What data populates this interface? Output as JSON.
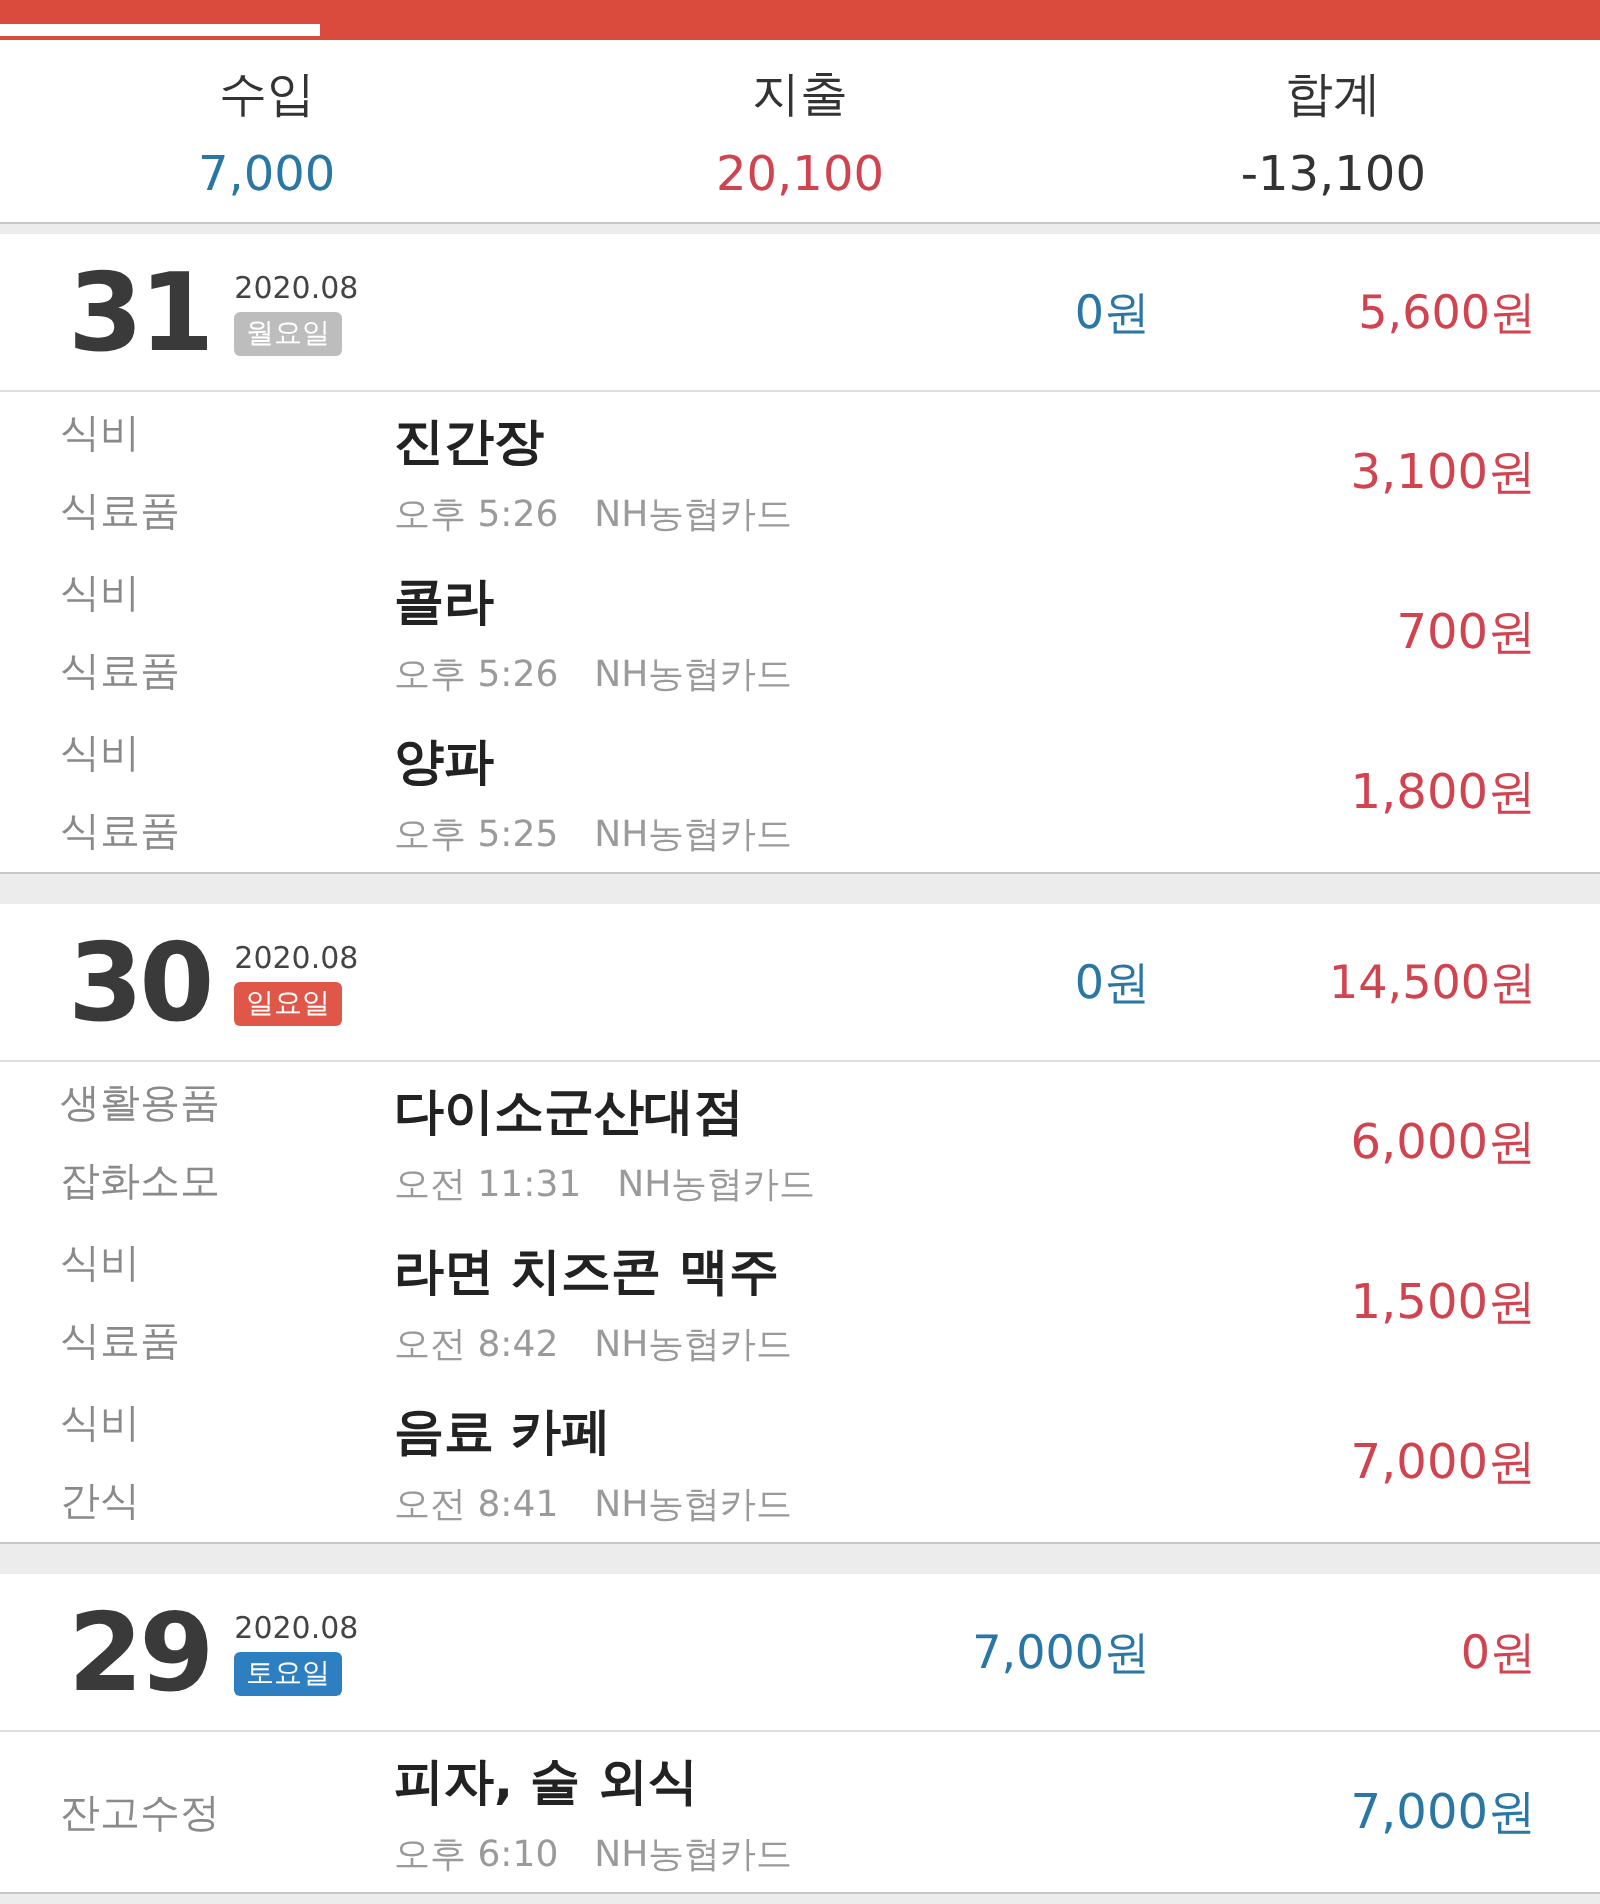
{
  "summary": [
    {
      "label": "수입",
      "value": "7,000",
      "kind": "income"
    },
    {
      "label": "지출",
      "value": "20,100",
      "kind": "expense"
    },
    {
      "label": "합계",
      "value": "-13,100",
      "kind": "total"
    }
  ],
  "days": [
    {
      "day": "31",
      "month": "2020.08",
      "weekday": "월요일",
      "color": "#bdbdbd",
      "income": "0원",
      "expense": "5,600원",
      "entries": [
        {
          "category": "식비",
          "subcategory": "식료품",
          "title": "진간장",
          "time": "오후 5:26",
          "account": "NH농협카드",
          "amount": "3,100원",
          "kind": "expense"
        },
        {
          "category": "식비",
          "subcategory": "식료품",
          "title": "콜라",
          "time": "오후 5:26",
          "account": "NH농협카드",
          "amount": "700원",
          "kind": "expense"
        },
        {
          "category": "식비",
          "subcategory": "식료품",
          "title": "양파",
          "time": "오후 5:25",
          "account": "NH농협카드",
          "amount": "1,800원",
          "kind": "expense"
        }
      ]
    },
    {
      "day": "30",
      "month": "2020.08",
      "weekday": "일요일",
      "color": "#e0574a",
      "income": "0원",
      "expense": "14,500원",
      "entries": [
        {
          "category": "생활용품",
          "subcategory": "잡화소모",
          "title": "다이소군산대점",
          "time": "오전 11:31",
          "account": "NH농협카드",
          "amount": "6,000원",
          "kind": "expense"
        },
        {
          "category": "식비",
          "subcategory": "식료품",
          "title": "라면 치즈콘 맥주",
          "time": "오전 8:42",
          "account": "NH농협카드",
          "amount": "1,500원",
          "kind": "expense"
        },
        {
          "category": "식비",
          "subcategory": "간식",
          "title": "음료 카페",
          "time": "오전 8:41",
          "account": "NH농협카드",
          "amount": "7,000원",
          "kind": "expense"
        }
      ]
    },
    {
      "day": "29",
      "month": "2020.08",
      "weekday": "토요일",
      "color": "#2d7fc1",
      "income": "7,000원",
      "expense": "0원",
      "entries": [
        {
          "category": "잔고수정",
          "title": "피자, 술 외식",
          "time": "오후 6:10",
          "account": "NH농협카드",
          "amount": "7,000원",
          "kind": "income"
        }
      ]
    }
  ]
}
